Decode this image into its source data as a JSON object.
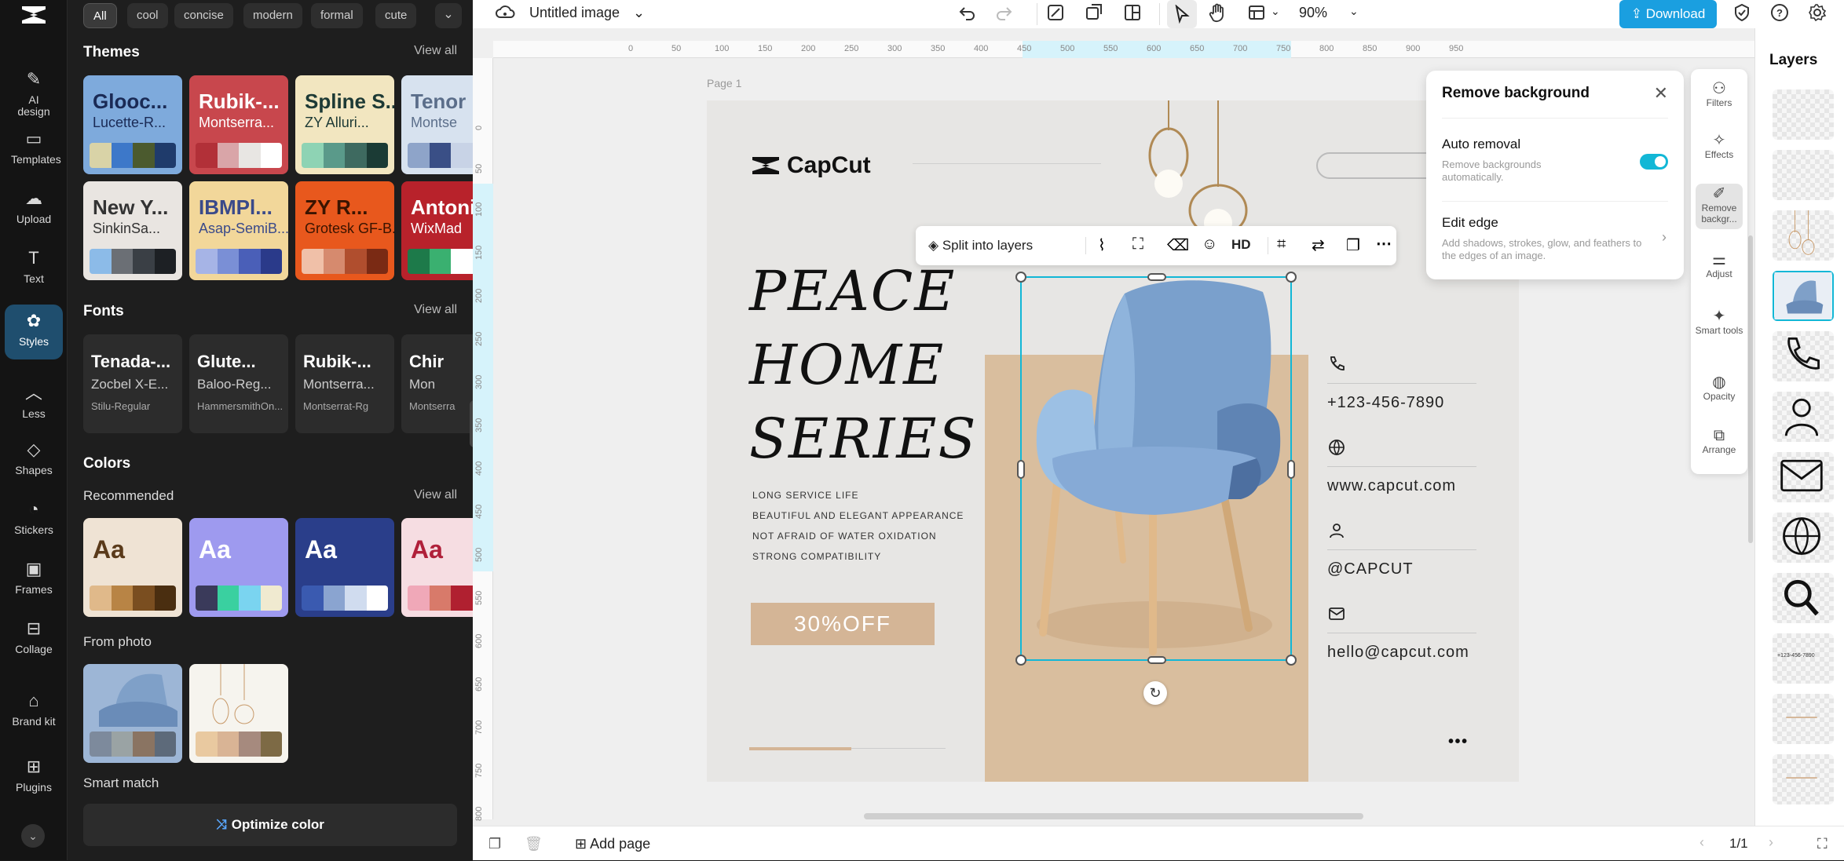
{
  "rail": {
    "items": [
      {
        "label": "AI design",
        "icon": "ai-design-icon"
      },
      {
        "label": "Templates",
        "icon": "templates-icon"
      },
      {
        "label": "Upload",
        "icon": "upload-icon"
      },
      {
        "label": "Text",
        "icon": "text-icon"
      },
      {
        "label": "Styles",
        "icon": "styles-icon",
        "active": true
      },
      {
        "label": "Less",
        "icon": "chevron-up-icon"
      },
      {
        "label": "Shapes",
        "icon": "shapes-icon"
      },
      {
        "label": "Stickers",
        "icon": "stickers-icon"
      },
      {
        "label": "Frames",
        "icon": "frames-icon"
      },
      {
        "label": "Collage",
        "icon": "collage-icon"
      },
      {
        "label": "Brand kit",
        "icon": "brand-kit-icon"
      },
      {
        "label": "Plugins",
        "icon": "plugins-icon"
      }
    ]
  },
  "panel": {
    "chips": [
      "All",
      "cool",
      "concise",
      "modern",
      "formal",
      "cute"
    ],
    "themes": {
      "title": "Themes",
      "view_all": "View all",
      "cards": [
        {
          "t1": "Glooc...",
          "t2": "Lucette-R...",
          "bg": "#7eaadc",
          "fg": "#1a2a55",
          "sw": [
            "#d9d3a7",
            "#3d78c9",
            "#4b5a2e",
            "#1f3b6b"
          ]
        },
        {
          "t1": "Rubik-...",
          "t2": "Montserra...",
          "bg": "#c8474d",
          "fg": "#ffffff",
          "sw": [
            "#b23038",
            "#d9a5a8",
            "#e8e6e3",
            "#ffffff"
          ]
        },
        {
          "t1": "Spline S...",
          "t2": "ZY Alluri...",
          "bg": "#f2e6c0",
          "fg": "#1d3a35",
          "sw": [
            "#8ed3b4",
            "#5a9a8a",
            "#3e6a60",
            "#1b3b35"
          ]
        },
        {
          "t1": "Tenor",
          "t2": "Montse",
          "bg": "#d7e2ef",
          "fg": "#5b6e8a",
          "sw": [
            "#8ea4c9",
            "#3a4f86",
            "#c8d3e6",
            "#ffffff"
          ]
        },
        {
          "t1": "New Y...",
          "t2": "SinkinSa...",
          "bg": "#e9e5e1",
          "fg": "#333333",
          "sw": [
            "#8cbbe8",
            "#6b6f75",
            "#3a3f45",
            "#1d2024"
          ]
        },
        {
          "t1": "IBMPl...",
          "t2": "Asap-SemiB...",
          "bg": "#f2d79a",
          "fg": "#3a4a8a",
          "sw": [
            "#a6b4e6",
            "#7a8fd6",
            "#4a5fb8",
            "#2a3a8a"
          ]
        },
        {
          "t1": "ZY R...",
          "t2": "Grotesk GF-B...",
          "bg": "#e8581d",
          "fg": "#3a1400",
          "sw": [
            "#f0c0a8",
            "#d68a6e",
            "#b04e2e",
            "#7a2a14"
          ]
        },
        {
          "t1": "Antonio",
          "t2": "WixMad",
          "bg": "#b8222b",
          "fg": "#ffffff",
          "sw": [
            "#1d7a4a",
            "#3ab070",
            "#ffffff",
            "#e8e8e8"
          ]
        }
      ]
    },
    "fonts": {
      "title": "Fonts",
      "view_all": "View all",
      "cards": [
        {
          "f1": "Tenada-...",
          "f2": "Zocbel X-E...",
          "f3": "Stilu-Regular"
        },
        {
          "f1": "Glute...",
          "f2": "Baloo-Reg...",
          "f3": "HammersmithOn..."
        },
        {
          "f1": "Rubik-...",
          "f2": "Montserra...",
          "f3": "Montserrat-Rg"
        },
        {
          "f1": "Chir",
          "f2": "Mon",
          "f3": "Montserra"
        }
      ]
    },
    "colors": {
      "title": "Colors",
      "recommended": "Recommended",
      "view_all": "View all",
      "cards": [
        {
          "aa": "Aa",
          "bg": "#efe3d4",
          "fg": "#5a3a1a",
          "sw": [
            "#e0b98a",
            "#b88445",
            "#7a4e20",
            "#4a2e10"
          ]
        },
        {
          "aa": "Aa",
          "bg": "#9e9aef",
          "fg": "#ffffff",
          "sw": [
            "#3a3a5a",
            "#3ad0a0",
            "#7ad4f0",
            "#f0ead0"
          ]
        },
        {
          "aa": "Aa",
          "bg": "#2a3e8a",
          "fg": "#ffffff",
          "sw": [
            "#3a5ab0",
            "#8aa4d0",
            "#d0dcef",
            "#ffffff"
          ]
        },
        {
          "aa": "Aa",
          "bg": "#f6dde2",
          "fg": "#b0203a",
          "sw": [
            "#f0a8b8",
            "#d87a6a",
            "#b02030",
            "#ffffff"
          ]
        }
      ],
      "from_photo": "From photo",
      "photo_cards": [
        {
          "sw": [
            "#7d8a9c",
            "#9aa3a4",
            "#8a7462",
            "#5d6a7a"
          ]
        },
        {
          "sw": [
            "#e9c9a0",
            "#d9b495",
            "#a68a7e",
            "#7d6a45"
          ]
        }
      ],
      "smart_match": "Smart match",
      "optimize": "Optimize color"
    }
  },
  "topbar": {
    "title": "Untitled image",
    "zoom": "90%",
    "download": "Download"
  },
  "ruler": {
    "h_ticks": [
      "0",
      "50",
      "100",
      "150",
      "200",
      "250",
      "300",
      "350",
      "400",
      "450",
      "500",
      "550",
      "600",
      "650",
      "700",
      "750",
      "800",
      "850",
      "900",
      "950"
    ],
    "v_ticks": [
      "0",
      "50",
      "100",
      "150",
      "200",
      "250",
      "300",
      "350",
      "400",
      "450",
      "500",
      "550",
      "600",
      "650",
      "700",
      "750",
      "800"
    ]
  },
  "canvas": {
    "page_label": "Page 1"
  },
  "design": {
    "logo": "CapCut",
    "headline": [
      "PEACE",
      "HOME",
      "SERIES"
    ],
    "bullets": [
      "LONG SERVICE LIFE",
      "BEAUTIFUL AND ELEGANT APPEARANCE",
      "NOT AFRAID OF WATER OXIDATION",
      "STRONG COMPATIBILITY"
    ],
    "offer": "30%OFF",
    "contacts": [
      {
        "icon": "phone-icon",
        "text": "+123-456-7890"
      },
      {
        "icon": "globe-icon",
        "text": "www.capcut.com"
      },
      {
        "icon": "user-icon",
        "text": "@CAPCUT"
      },
      {
        "icon": "mail-icon",
        "text": "hello@capcut.com"
      }
    ],
    "dots": "• • •"
  },
  "context_toolbar": {
    "split": "Split into layers",
    "hd": "HD"
  },
  "popup": {
    "title": "Remove background",
    "auto_title": "Auto removal",
    "auto_desc": "Remove backgrounds automatically.",
    "edge_title": "Edit edge",
    "edge_desc": "Add shadows, strokes, glow, and feathers to the edges of an image.",
    "toggle_on": true
  },
  "tools": [
    {
      "label": "Filters"
    },
    {
      "label": "Effects"
    },
    {
      "label": "Remove backgr..."
    },
    {
      "label": "Adjust"
    },
    {
      "label": "Smart tools"
    },
    {
      "label": "Opacity"
    },
    {
      "label": "Arrange"
    }
  ],
  "layers": {
    "title": "Layers",
    "items": [
      {
        "kind": "blank"
      },
      {
        "kind": "blank"
      },
      {
        "kind": "lamp"
      },
      {
        "kind": "chair",
        "selected": true
      },
      {
        "kind": "phone"
      },
      {
        "kind": "user"
      },
      {
        "kind": "mail"
      },
      {
        "kind": "globe"
      },
      {
        "kind": "search"
      },
      {
        "kind": "text",
        "text": "+123-456-7890"
      },
      {
        "kind": "line"
      },
      {
        "kind": "line"
      }
    ]
  },
  "bottombar": {
    "add_page": "Add page",
    "page_count": "1/1"
  },
  "colors": {
    "accent": "#12b7d6",
    "download_bg": "#1a9fe0",
    "rail_active": "#1f4e6e"
  }
}
